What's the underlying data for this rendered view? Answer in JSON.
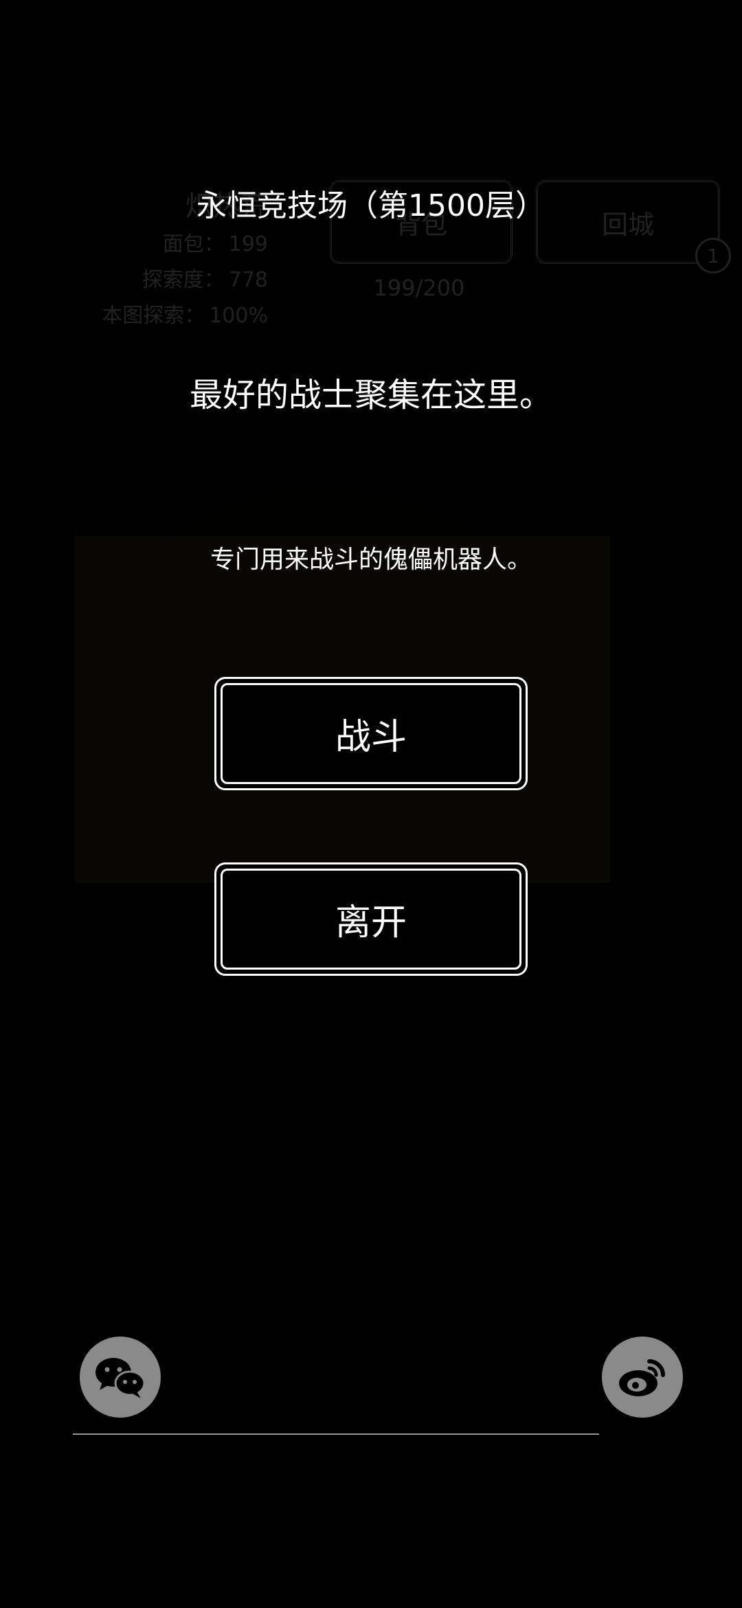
{
  "background": {
    "area_name": "炽热荒",
    "stats": [
      {
        "label": "面包：",
        "value": "199"
      },
      {
        "label": "探索度：",
        "value": "778"
      },
      {
        "label": "本图探索：",
        "value": "100%"
      }
    ],
    "bag_button_label": "背包",
    "home_button_label": "回城",
    "home_badge": "1",
    "bag_capacity": "199/200"
  },
  "dialog": {
    "title": "永恒竞技场（第1500层）",
    "headline": "最好的战士聚集在这里。",
    "description": "专门用来战斗的傀儡机器人。",
    "fight_label": "战斗",
    "leave_label": "离开"
  },
  "share": {
    "wechat_icon": "wechat-icon",
    "weibo_icon": "weibo-icon"
  }
}
